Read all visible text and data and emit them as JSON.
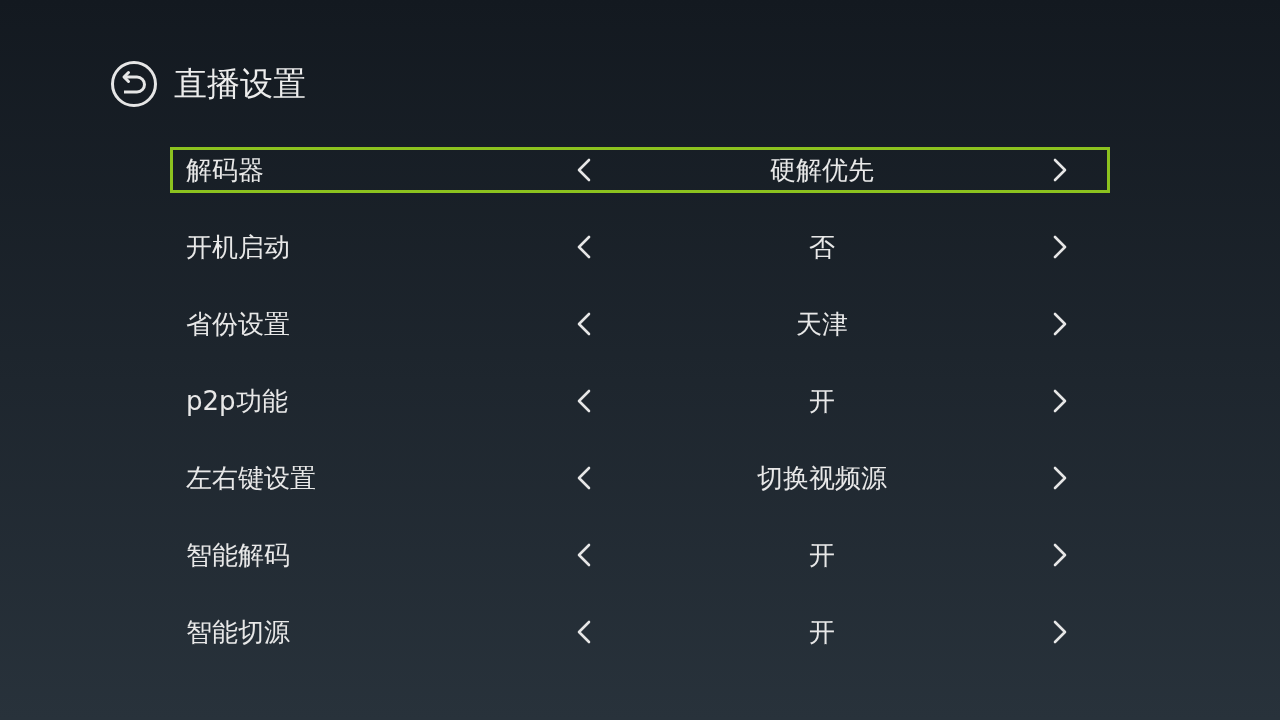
{
  "header": {
    "title": "直播设置"
  },
  "settings": [
    {
      "label": "解码器",
      "value": "硬解优先",
      "selected": true
    },
    {
      "label": "开机启动",
      "value": "否",
      "selected": false
    },
    {
      "label": "省份设置",
      "value": "天津",
      "selected": false
    },
    {
      "label": "p2p功能",
      "value": "开",
      "selected": false
    },
    {
      "label": "左右键设置",
      "value": "切换视频源",
      "selected": false
    },
    {
      "label": "智能解码",
      "value": "开",
      "selected": false
    },
    {
      "label": "智能切源",
      "value": "开",
      "selected": false
    }
  ]
}
